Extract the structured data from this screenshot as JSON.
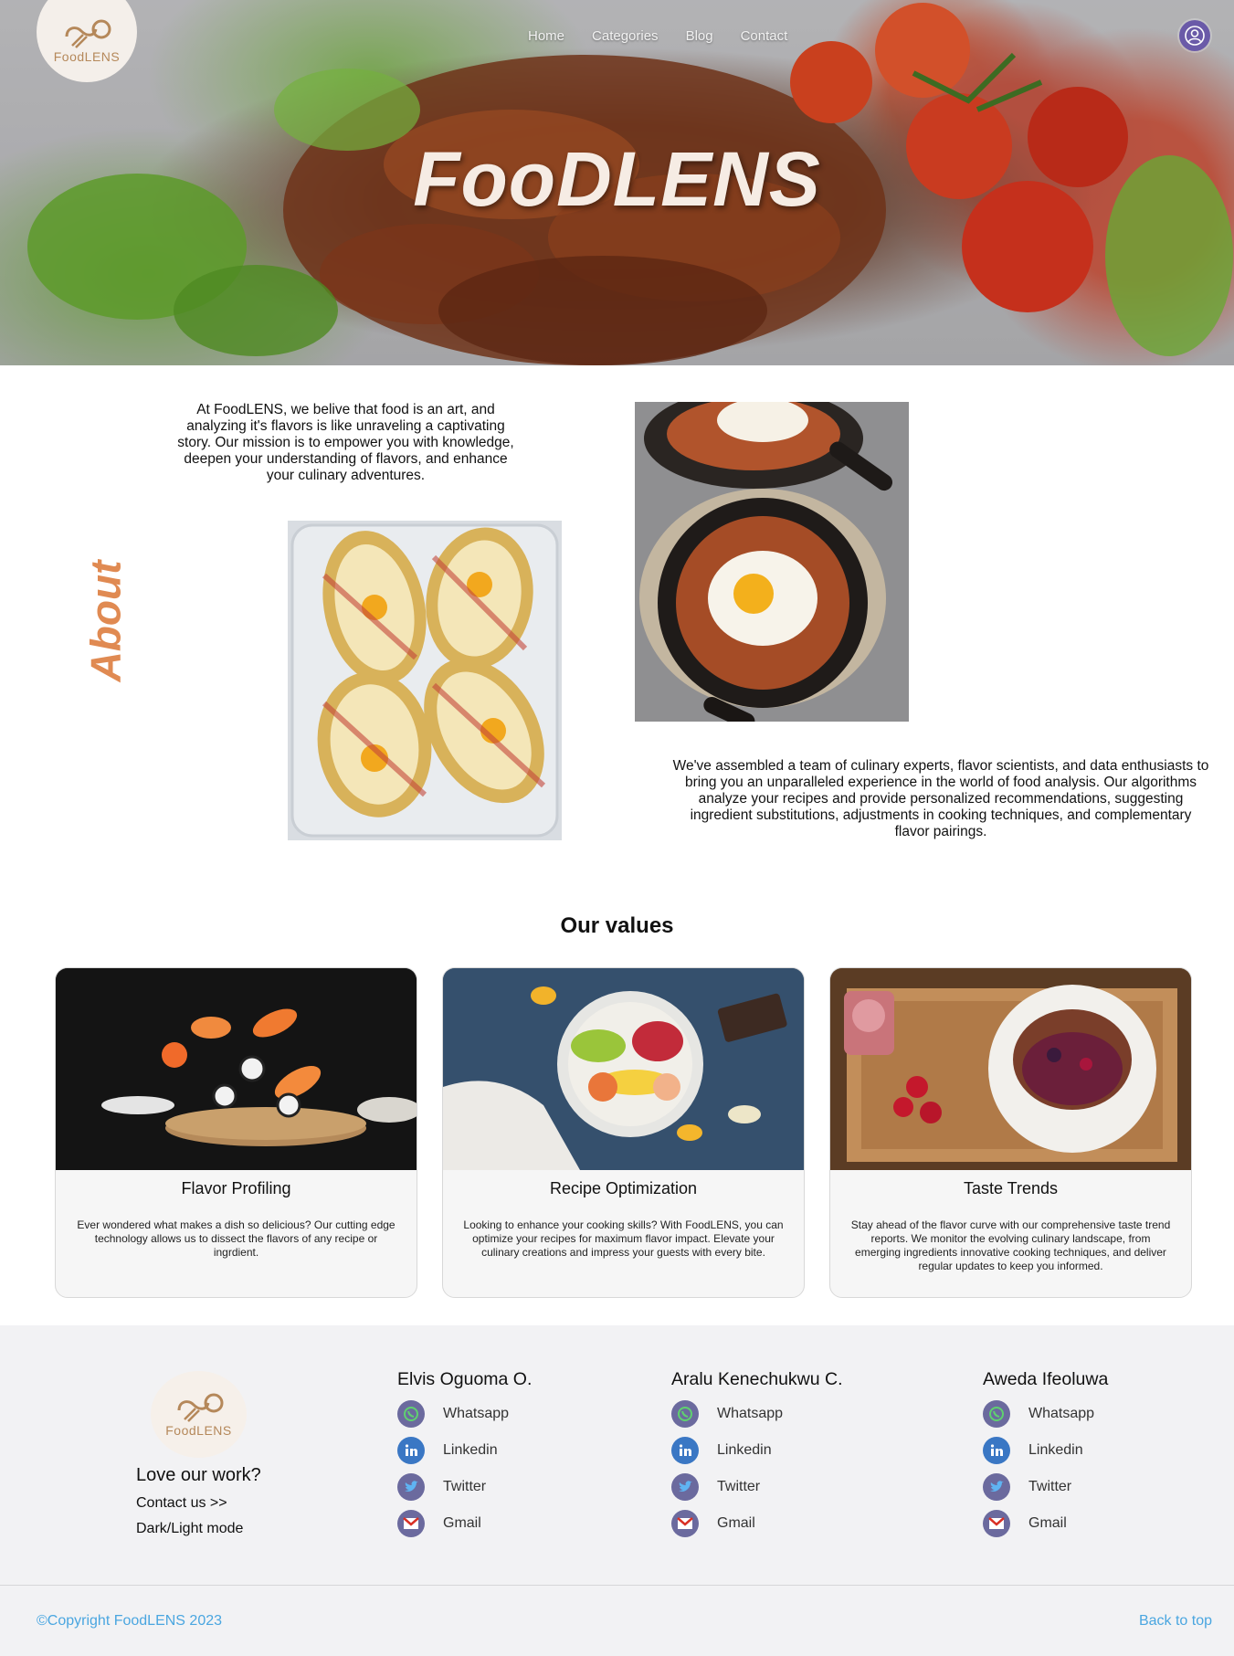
{
  "brand": {
    "logo_text": "FoodLENS",
    "hero_title": "FooDLENS"
  },
  "nav": {
    "items": [
      {
        "label": "Home"
      },
      {
        "label": "Categories"
      },
      {
        "label": "Blog"
      },
      {
        "label": "Contact"
      }
    ]
  },
  "about": {
    "heading": "About",
    "para1": "At FoodLENS, we belive that food is an art, and analyzing it's flavors is like unraveling a captivating story. Our mission is to empower you with knowledge, deepen your understanding of flavors, and enhance your culinary adventures.",
    "para2": "We've assembled a team of culinary experts, flavor scientists, and data enthusiasts to bring you an unparalleled experience in the world of food analysis. Our algorithms analyze your recipes and provide personalized recommendations, suggesting ingredient substitutions, adjustments in cooking techniques, and complementary flavor pairings."
  },
  "values": {
    "heading": "Our values",
    "cards": [
      {
        "title": "Flavor Profiling",
        "text": "Ever wondered what makes a dish so delicious? Our cutting edge technology allows us to dissect the flavors of any recipe or ingrdient."
      },
      {
        "title": "Recipe Optimization",
        "text": "Looking to enhance your cooking skills? With FoodLENS, you can optimize your recipes for maximum flavor impact. Elevate your culinary creations and impress your guests with every bite."
      },
      {
        "title": "Taste Trends",
        "text": "Stay ahead of the flavor curve with our comprehensive taste trend reports. We monitor the evolving culinary landscape, from emerging ingredients innovative cooking techniques, and deliver regular updates to keep you informed."
      }
    ]
  },
  "footer": {
    "love": "Love our work?",
    "contact": "Contact us >>",
    "mode": "Dark/Light mode",
    "members": [
      {
        "name": "Elvis Oguoma O.",
        "links": [
          "Whatsapp",
          "Linkedin",
          "Twitter",
          "Gmail"
        ]
      },
      {
        "name": "Aralu Kenechukwu C.",
        "links": [
          "Whatsapp",
          "Linkedin",
          "Twitter",
          "Gmail"
        ]
      },
      {
        "name": "Aweda Ifeoluwa",
        "links": [
          "Whatsapp",
          "Linkedin",
          "Twitter",
          "Gmail"
        ]
      }
    ],
    "copyright": "©Copyright FoodLENS 2023",
    "back_to_top": "Back to top"
  },
  "colors": {
    "accent": "#e08a52",
    "link": "#4aa6e0",
    "icon_bg": "#6b6a9e",
    "user_btn": "#6a5aa8"
  }
}
